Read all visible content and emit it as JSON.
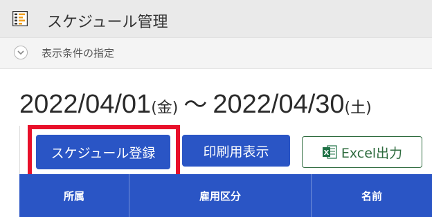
{
  "app": {
    "title": "スケジュール管理",
    "icon": "schedule-list-icon"
  },
  "filter": {
    "label": "表示条件の指定",
    "icon": "chevron-down-icon"
  },
  "date_range": {
    "start_date": "2022/04/01",
    "start_weekday": "(金)",
    "separator": "～",
    "end_date": "2022/04/30",
    "end_weekday": "(土)"
  },
  "toolbar": {
    "register_label": "スケジュール登録",
    "print_label": "印刷用表示",
    "excel_label": "Excel出力",
    "excel_icon": "excel-icon"
  },
  "table": {
    "columns": [
      "所属",
      "雇用区分",
      "名前"
    ]
  },
  "colors": {
    "primary": "#2a55c5",
    "highlight": "#e8102a",
    "excel_green": "#1e7145"
  }
}
